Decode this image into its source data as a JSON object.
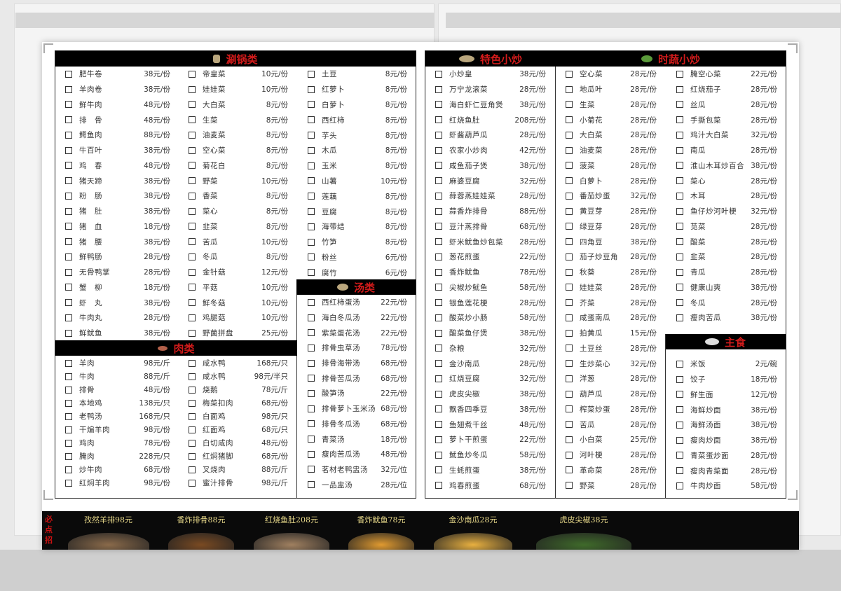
{
  "left_page": {
    "hotpot": {
      "title": "涮锅类",
      "col1": [
        [
          "肥牛卷",
          "38元/份"
        ],
        [
          "羊肉卷",
          "38元/份"
        ],
        [
          "鲜牛肉",
          "48元/份"
        ],
        [
          "排　骨",
          "48元/份"
        ],
        [
          "鳄鱼肉",
          "88元/份"
        ],
        [
          "牛百叶",
          "38元/份"
        ],
        [
          "鸡　春",
          "48元/份"
        ],
        [
          "猪天蹄",
          "38元/份"
        ],
        [
          "粉　肠",
          "38元/份"
        ],
        [
          "猪　肚",
          "38元/份"
        ],
        [
          "猪　血",
          "18元/份"
        ],
        [
          "猪　腰",
          "38元/份"
        ],
        [
          "鲜鸭肠",
          "28元/份"
        ],
        [
          "无骨鸭掌",
          "28元/份"
        ],
        [
          "蟹　柳",
          "18元/份"
        ],
        [
          "虾　丸",
          "38元/份"
        ],
        [
          "牛肉丸",
          "28元/份"
        ],
        [
          "鲜鱿鱼",
          "38元/份"
        ]
      ],
      "col2": [
        [
          "帝皇菜",
          "10元/份"
        ],
        [
          "娃娃菜",
          "10元/份"
        ],
        [
          "大白菜",
          "8元/份"
        ],
        [
          "生菜",
          "8元/份"
        ],
        [
          "油麦菜",
          "8元/份"
        ],
        [
          "空心菜",
          "8元/份"
        ],
        [
          "菊花白",
          "8元/份"
        ],
        [
          "野菜",
          "10元/份"
        ],
        [
          "香菜",
          "8元/份"
        ],
        [
          "菜心",
          "8元/份"
        ],
        [
          "韭菜",
          "8元/份"
        ],
        [
          "苦瓜",
          "10元/份"
        ],
        [
          "冬瓜",
          "8元/份"
        ],
        [
          "金针菇",
          "12元/份"
        ],
        [
          "平菇",
          "10元/份"
        ],
        [
          "鲜冬菇",
          "10元/份"
        ],
        [
          "鸡腿菇",
          "10元/份"
        ],
        [
          "野菌拼盘",
          "25元/份"
        ]
      ],
      "col3": [
        [
          "土豆",
          "8元/份"
        ],
        [
          "红萝卜",
          "8元/份"
        ],
        [
          "白萝卜",
          "8元/份"
        ],
        [
          "西红柿",
          "8元/份"
        ],
        [
          "芋头",
          "8元/份"
        ],
        [
          "木瓜",
          "8元/份"
        ],
        [
          "玉米",
          "8元/份"
        ],
        [
          "山薯",
          "10元/份"
        ],
        [
          "莲藕",
          "8元/份"
        ],
        [
          "豆腐",
          "8元/份"
        ],
        [
          "海带结",
          "8元/份"
        ],
        [
          "竹笋",
          "8元/份"
        ],
        [
          "粉丝",
          "6元/份"
        ],
        [
          "腐竹",
          "6元/份"
        ]
      ]
    },
    "meat": {
      "title": "肉类",
      "col1": [
        [
          "羊肉",
          "98元/斤"
        ],
        [
          "牛肉",
          "88元/斤"
        ],
        [
          "排骨",
          "48元/份"
        ],
        [
          "本地鸡",
          "138元/只"
        ],
        [
          "老鸭汤",
          "168元/只"
        ],
        [
          "干煸羊肉",
          "98元/份"
        ],
        [
          "鸡肉",
          "78元/份"
        ],
        [
          "腌肉",
          "228元/只"
        ],
        [
          "炒牛肉",
          "68元/份"
        ],
        [
          "红焖羊肉",
          "98元/份"
        ]
      ],
      "col2": [
        [
          "咸水鸭",
          "168元/只"
        ],
        [
          "咸水鸭",
          "98元/半只"
        ],
        [
          "烧鹅",
          "78元/斤"
        ],
        [
          "梅菜扣肉",
          "68元/份"
        ],
        [
          "白面鸡",
          "98元/只"
        ],
        [
          "红面鸡",
          "68元/只"
        ],
        [
          "白切咸肉",
          "48元/份"
        ],
        [
          "红焖猪脚",
          "68元/份"
        ],
        [
          "叉烧肉",
          "88元/斤"
        ],
        [
          "蜜汁排骨",
          "98元/斤"
        ]
      ]
    },
    "soup": {
      "title": "汤类",
      "items": [
        [
          "西红柿蛋汤",
          "22元/份"
        ],
        [
          "海白冬瓜汤",
          "22元/份"
        ],
        [
          "紫菜蛋花汤",
          "22元/份"
        ],
        [
          "排骨虫草汤",
          "78元/份"
        ],
        [
          "排骨海带汤",
          "68元/份"
        ],
        [
          "排骨苦瓜汤",
          "68元/份"
        ],
        [
          "酸笋汤",
          "22元/份"
        ],
        [
          "排骨萝卜玉米汤",
          "68元/份"
        ],
        [
          "排骨冬瓜汤",
          "68元/份"
        ],
        [
          "青菜汤",
          "18元/份"
        ],
        [
          "瘦肉苦瓜汤",
          "48元/份"
        ],
        [
          "茗材老鸭盅汤",
          "32元/位"
        ],
        [
          "一品盅汤",
          "28元/位"
        ]
      ]
    }
  },
  "right_page": {
    "special": {
      "title": "特色小炒",
      "items": [
        [
          "小炒皇",
          "38元/份"
        ],
        [
          "万宁龙滚菜",
          "28元/份"
        ],
        [
          "海白虾仁豆角煲",
          "38元/份"
        ],
        [
          "红烧鱼肚",
          "208元/份"
        ],
        [
          "虾酱葫芦瓜",
          "28元/份"
        ],
        [
          "农家小炒肉",
          "42元/份"
        ],
        [
          "咸鱼茄子煲",
          "38元/份"
        ],
        [
          "麻婆豆腐",
          "32元/份"
        ],
        [
          "蒜蓉蒸娃娃菜",
          "28元/份"
        ],
        [
          "蒜香炸排骨",
          "88元/份"
        ],
        [
          "豆汁蒸排骨",
          "68元/份"
        ],
        [
          "虾米鱿鱼炒包菜",
          "28元/份"
        ],
        [
          "葱花煎蛋",
          "22元/份"
        ],
        [
          "香炸鱿鱼",
          "78元/份"
        ],
        [
          "尖椒炒鱿鱼",
          "58元/份"
        ],
        [
          "银鱼莲花梗",
          "28元/份"
        ],
        [
          "酸菜炒小肠",
          "58元/份"
        ],
        [
          "酸菜鱼仔煲",
          "38元/份"
        ],
        [
          "杂粮",
          "32元/份"
        ],
        [
          "金沙南瓜",
          "28元/份"
        ],
        [
          "红烧豆腐",
          "32元/份"
        ],
        [
          "虎皮尖椒",
          "38元/份"
        ],
        [
          "飘香四季豆",
          "38元/份"
        ],
        [
          "鱼翅煮千丝",
          "48元/份"
        ],
        [
          "萝卜干煎蛋",
          "22元/份"
        ],
        [
          "鱿鱼炒冬瓜",
          "58元/份"
        ],
        [
          "生蚝煎蛋",
          "38元/份"
        ],
        [
          "鸡春煎蛋",
          "68元/份"
        ]
      ]
    },
    "veg": {
      "title": "时蔬小炒",
      "col1": [
        [
          "空心菜",
          "28元/份"
        ],
        [
          "地瓜叶",
          "28元/份"
        ],
        [
          "生菜",
          "28元/份"
        ],
        [
          "小菊花",
          "28元/份"
        ],
        [
          "大白菜",
          "28元/份"
        ],
        [
          "油麦菜",
          "28元/份"
        ],
        [
          "菠菜",
          "28元/份"
        ],
        [
          "白萝卜",
          "28元/份"
        ],
        [
          "番茄炒蛋",
          "32元/份"
        ],
        [
          "黄豆芽",
          "28元/份"
        ],
        [
          "绿豆芽",
          "28元/份"
        ],
        [
          "四角豆",
          "38元/份"
        ],
        [
          "茄子炒豆角",
          "28元/份"
        ],
        [
          "秋葵",
          "28元/份"
        ],
        [
          "娃娃菜",
          "28元/份"
        ],
        [
          "芥菜",
          "28元/份"
        ],
        [
          "咸蛋南瓜",
          "28元/份"
        ],
        [
          "拍黄瓜",
          "15元/份"
        ],
        [
          "土豆丝",
          "28元/份"
        ],
        [
          "生炒菜心",
          "32元/份"
        ],
        [
          "洋葱",
          "28元/份"
        ],
        [
          "葫芦瓜",
          "28元/份"
        ],
        [
          "榨菜炒蛋",
          "28元/份"
        ],
        [
          "苦瓜",
          "28元/份"
        ],
        [
          "小白菜",
          "25元/份"
        ],
        [
          "河叶梗",
          "28元/份"
        ],
        [
          "革命菜",
          "28元/份"
        ],
        [
          "野菜",
          "28元/份"
        ]
      ],
      "col2": [
        [
          "腌空心菜",
          "22元/份"
        ],
        [
          "红烧茄子",
          "28元/份"
        ],
        [
          "丝瓜",
          "28元/份"
        ],
        [
          "手撕包菜",
          "28元/份"
        ],
        [
          "鸡汁大白菜",
          "32元/份"
        ],
        [
          "南瓜",
          "28元/份"
        ],
        [
          "淮山木耳炒百合",
          "38元/份"
        ],
        [
          "菜心",
          "28元/份"
        ],
        [
          "木耳",
          "28元/份"
        ],
        [
          "鱼仔炒河叶梗",
          "32元/份"
        ],
        [
          "苋菜",
          "28元/份"
        ],
        [
          "酸菜",
          "28元/份"
        ],
        [
          "韭菜",
          "28元/份"
        ],
        [
          "青瓜",
          "28元/份"
        ],
        [
          "健康山爽",
          "38元/份"
        ],
        [
          "冬瓜",
          "28元/份"
        ],
        [
          "瘦肉苦瓜",
          "38元/份"
        ]
      ]
    },
    "staple": {
      "title": "主食",
      "items": [
        [
          "米饭",
          "2元/碗"
        ],
        [
          "饺子",
          "18元/份"
        ],
        [
          "鲜生面",
          "12元/份"
        ],
        [
          "海鲜炒面",
          "38元/份"
        ],
        [
          "海鲜汤面",
          "38元/份"
        ],
        [
          "瘦肉炒面",
          "38元/份"
        ],
        [
          "青菜蛋炒面",
          "28元/份"
        ],
        [
          "瘦肉青菜面",
          "28元/份"
        ],
        [
          "牛肉炒面",
          "58元/份"
        ]
      ]
    }
  },
  "banner": {
    "must_order": "必点招",
    "promos": [
      {
        "caption": "孜然羊排98元",
        "color": "#8a6a4a"
      },
      {
        "caption": "香炸排骨88元",
        "color": "#7a4a22"
      },
      {
        "caption": "红烧鱼肚208元",
        "color": "#a08060"
      },
      {
        "caption": "香炸鱿鱼78元",
        "color": "#e09a30"
      },
      {
        "caption": "金沙南瓜28元",
        "color": "#e8b040"
      },
      {
        "caption": "虎皮尖椒38元",
        "color": "#3f6a2a"
      }
    ]
  },
  "colors": {
    "header_bg": "#000000",
    "header_text": "#d21b1b",
    "banner_bg": "#0a0a0a"
  }
}
